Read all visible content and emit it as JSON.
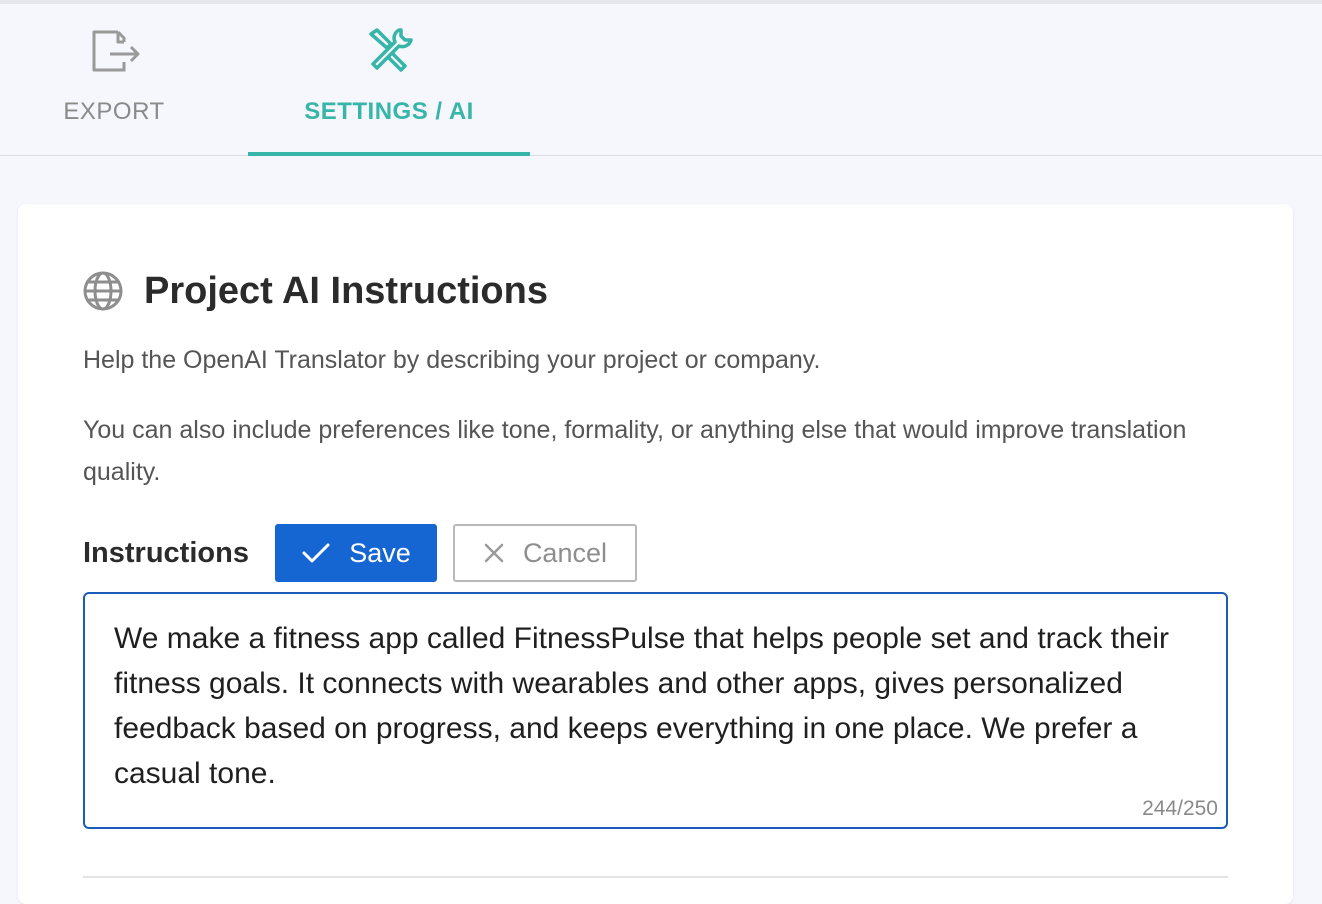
{
  "tabs": [
    {
      "label": "EXPORT",
      "icon": "export-icon",
      "active": false
    },
    {
      "label": "SETTINGS / AI",
      "icon": "tools-icon",
      "active": true
    }
  ],
  "colors": {
    "accent": "#36b5a8",
    "primary_button": "#1565d3",
    "background": "#f6f7fc"
  },
  "section": {
    "icon": "globe-icon",
    "title": "Project AI Instructions",
    "description_1": "Help the OpenAI Translator by describing your project or company.",
    "description_2": "You can also include preferences like tone, formality, or anything else that would improve translation quality."
  },
  "instructions": {
    "label": "Instructions",
    "save_label": "Save",
    "cancel_label": "Cancel",
    "value": "We make a fitness app called FitnessPulse that helps people set and track their fitness goals. It connects with wearables and other apps, gives personalized feedback based on progress, and keeps everything in one place. We prefer a casual tone.",
    "counter": "244/250"
  }
}
